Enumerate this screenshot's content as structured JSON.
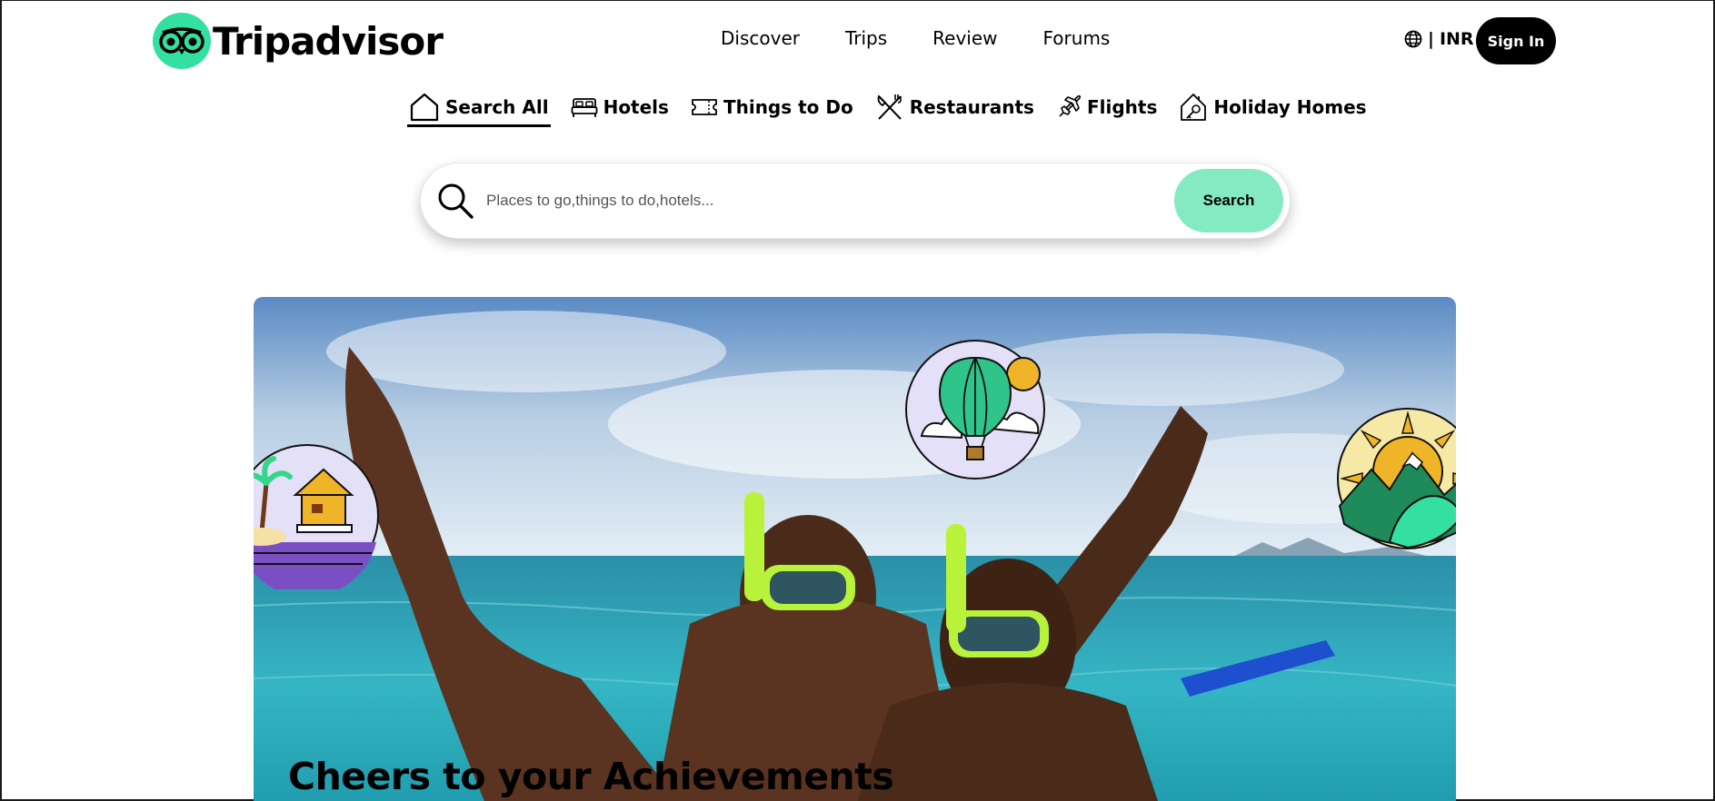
{
  "brand": {
    "name": "Tripadvisor",
    "accent": "#34e0a1",
    "logo_icon": "owl-eyes-icon"
  },
  "topnav": {
    "items": [
      "Discover",
      "Trips",
      "Review",
      "Forums"
    ]
  },
  "locale": {
    "separator": "|",
    "currency": "INR",
    "icon": "globe-icon"
  },
  "signin": {
    "label": "Sign In"
  },
  "tabs": [
    {
      "label": "Search All",
      "icon": "home-icon",
      "active": true
    },
    {
      "label": "Hotels",
      "icon": "bed-icon",
      "active": false
    },
    {
      "label": "Things to Do",
      "icon": "ticket-icon",
      "active": false
    },
    {
      "label": "Restaurants",
      "icon": "fork-knife-icon",
      "active": false
    },
    {
      "label": "Flights",
      "icon": "airplane-icon",
      "active": false
    },
    {
      "label": "Holiday Homes",
      "icon": "house-key-icon",
      "active": false
    }
  ],
  "search": {
    "placeholder": "Places to go,things to do,hotels...",
    "value": "",
    "button_label": "Search",
    "button_color": "#84eac2"
  },
  "hero": {
    "title": "Cheers to your Achievements",
    "badges": [
      "beach-hut-badge",
      "hot-air-balloon-badge",
      "mountain-sun-badge"
    ]
  }
}
